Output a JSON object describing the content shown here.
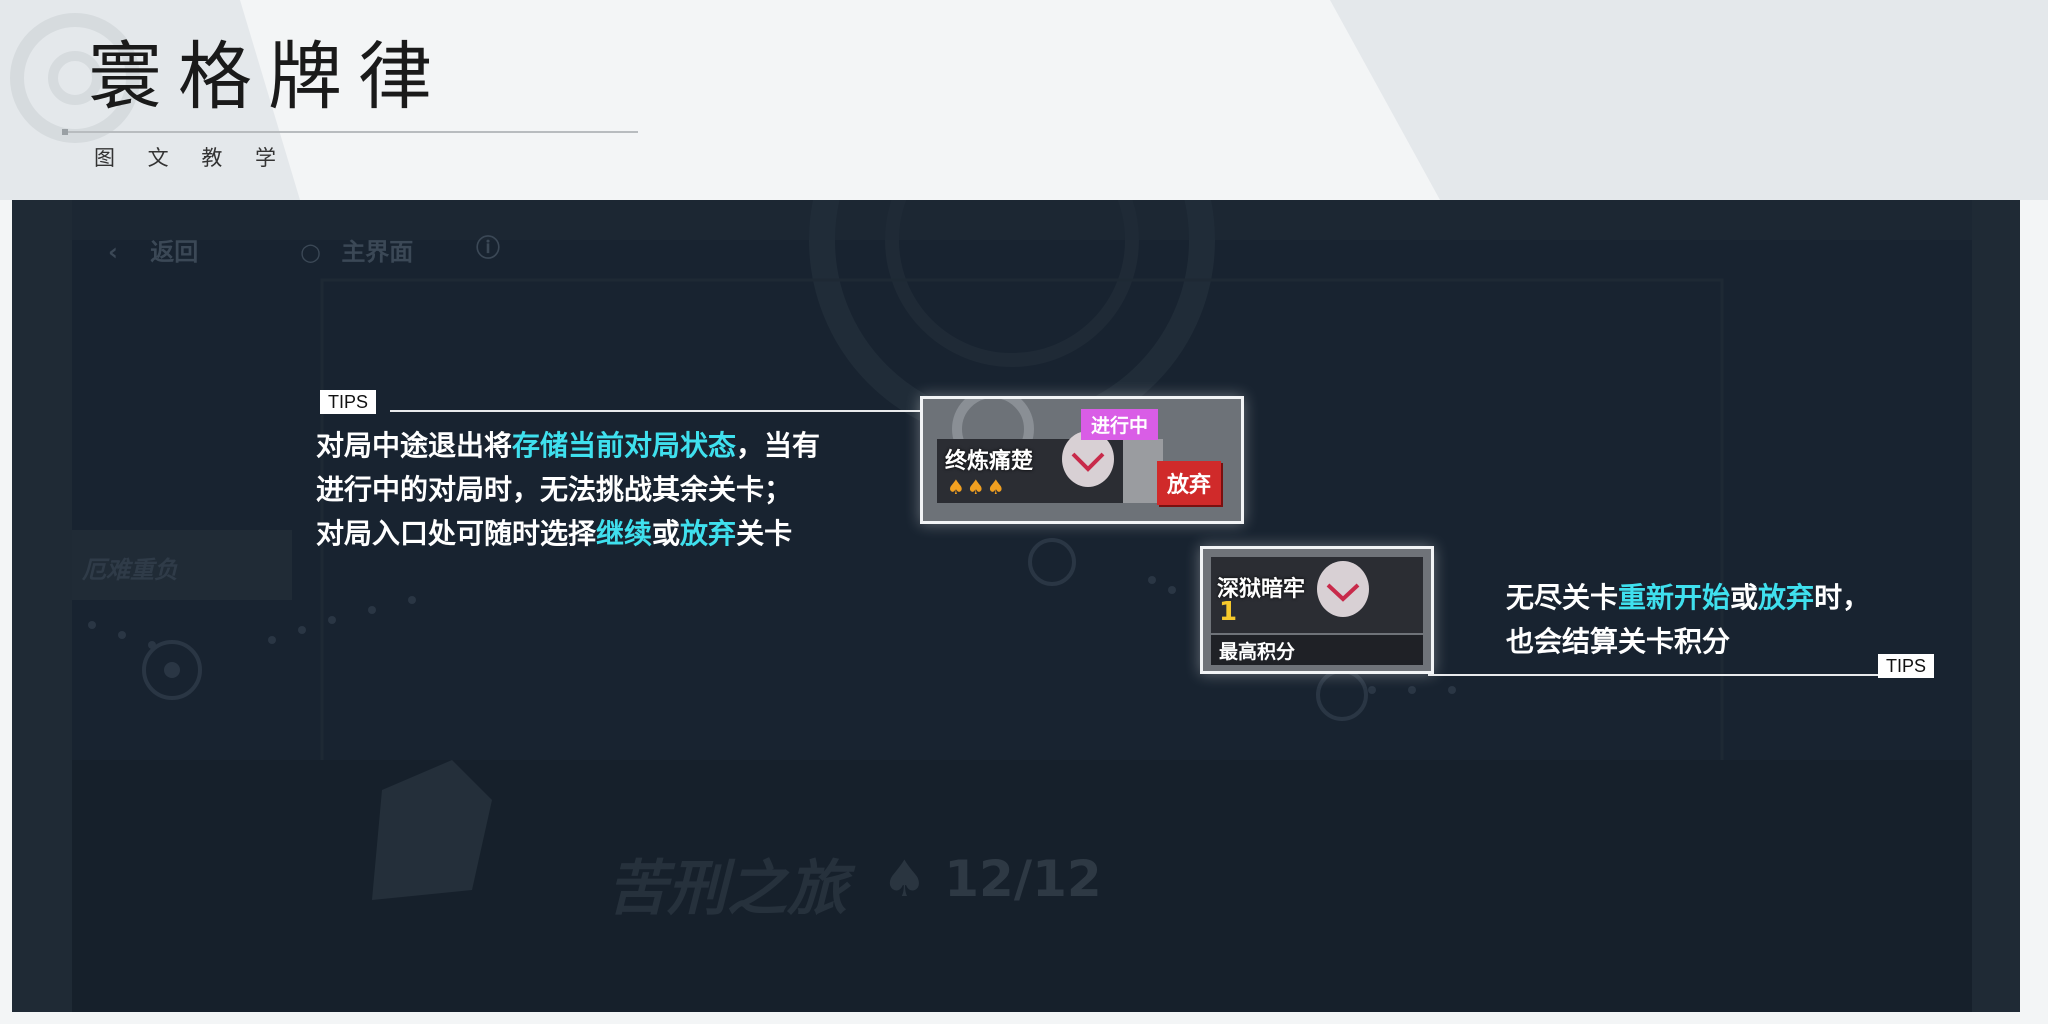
{
  "header": {
    "title": "寰格牌律",
    "subtitle": "图 文 教 学"
  },
  "game": {
    "nav": {
      "back_label": "返回",
      "home_label": "主界面",
      "info_icon": "info-icon"
    },
    "left_node_label": "厄难重负",
    "stage_name": "苦刑之旅",
    "progress": "12/12"
  },
  "tip1": {
    "tag": "TIPS",
    "line1_prefix": "对局中途退出将",
    "line1_highlight": "存储当前对局状态",
    "line1_suffix": "，当有",
    "line2": "进行中的对局时，无法挑战其余关卡；",
    "line3_prefix": "对局入口处可随时选择",
    "line3_hl1": "继续",
    "line3_mid": "或",
    "line3_hl2": "放弃",
    "line3_suffix": "关卡"
  },
  "card1": {
    "badge": "进行中",
    "name": "终炼痛楚",
    "abandon_label": "放弃",
    "spades": "♠♠♠"
  },
  "card2": {
    "name": "深狱暗牢",
    "level": "1",
    "score_label": "最高积分"
  },
  "tip2": {
    "tag": "TIPS",
    "line1_prefix": "无尽关卡",
    "line1_hl1": "重新开始",
    "line1_mid": "或",
    "line1_hl2": "放弃",
    "line1_suffix": "时，",
    "line2": "也会结算关卡积分"
  },
  "colors": {
    "highlight": "#3fe0ee",
    "badge": "#d95de6",
    "abandon": "#d02a2a",
    "background": "#182330"
  }
}
